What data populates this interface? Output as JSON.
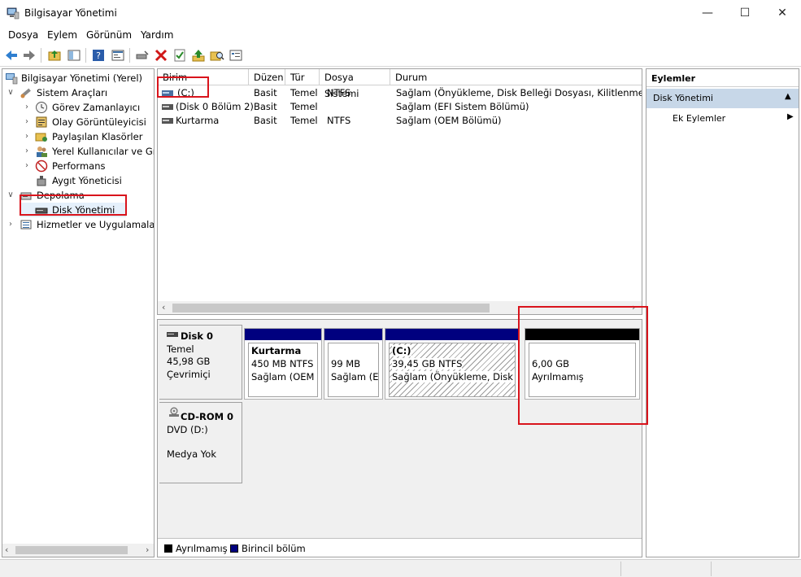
{
  "window": {
    "title": "Bilgisayar Yönetimi"
  },
  "menu": [
    "Dosya",
    "Eylem",
    "Görünüm",
    "Yardım"
  ],
  "tree": {
    "root": "Bilgisayar Yönetimi (Yerel)",
    "system_tools": "Sistem Araçları",
    "task_scheduler": "Görev Zamanlayıcı",
    "event_viewer": "Olay Görüntüleyicisi",
    "shared_folders": "Paylaşılan Klasörler",
    "local_users": "Yerel Kullanıcılar ve Gru",
    "performance": "Performans",
    "device_manager": "Aygıt Yöneticisi",
    "storage": "Depolama",
    "disk_management": "Disk Yönetimi",
    "services": "Hizmetler ve Uygulamalar"
  },
  "volumes": {
    "headers": [
      "Birim",
      "Düzen",
      "Tür",
      "Dosya Sistemi",
      "Durum"
    ],
    "rows": [
      {
        "name": "(C:)",
        "layout": "Basit",
        "type": "Temel",
        "fs": "NTFS",
        "status": "Sağlam (Önyükleme, Disk Belleği Dosyası, Kilitlenme Bilgi:"
      },
      {
        "name": "(Disk 0 Bölüm 2)",
        "layout": "Basit",
        "type": "Temel",
        "fs": "",
        "status": "Sağlam (EFI Sistem Bölümü)"
      },
      {
        "name": "Kurtarma",
        "layout": "Basit",
        "type": "Temel",
        "fs": "NTFS",
        "status": "Sağlam (OEM Bölümü)"
      }
    ]
  },
  "disk0": {
    "name": "Disk 0",
    "type": "Temel",
    "size": "45,98 GB",
    "state": "Çevrimiçi",
    "partitions": [
      {
        "name": "Kurtarma",
        "size": "450 MB NTFS",
        "status": "Sağlam (OEM B"
      },
      {
        "name": "",
        "size": "99 MB",
        "status": "Sağlam (EF"
      },
      {
        "name": "(C:)",
        "size": "39,45 GB NTFS",
        "status": "Sağlam (Önyükleme, Disk Bell"
      },
      {
        "name": "",
        "size": "6,00 GB",
        "status": "Ayrılmamış"
      }
    ]
  },
  "cdrom0": {
    "name": "CD-ROM 0",
    "drive": "DVD (D:)",
    "state": "Medya Yok"
  },
  "legend": {
    "unallocated": "Ayrılmamış",
    "primary": "Birincil bölüm"
  },
  "actions": {
    "title": "Eylemler",
    "section": "Disk Yönetimi",
    "more": "Ek Eylemler"
  },
  "colors": {
    "primary": "#00007f",
    "unallocated": "#000000",
    "selection": "#c7d7e8",
    "highlight": "#d9141c"
  }
}
